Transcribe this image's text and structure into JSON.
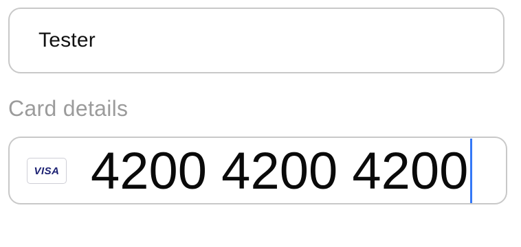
{
  "name_field": {
    "value": "Tester"
  },
  "card_section": {
    "label": "Card details",
    "brand_icon": "visa-card-icon",
    "brand_text": "VISA",
    "number_value": "4200 4200 4200",
    "caret_color": "#3478f6"
  },
  "colors": {
    "border": "#c8c8c8",
    "label_text": "#9b9b9b",
    "visa_blue": "#1a1f71"
  }
}
